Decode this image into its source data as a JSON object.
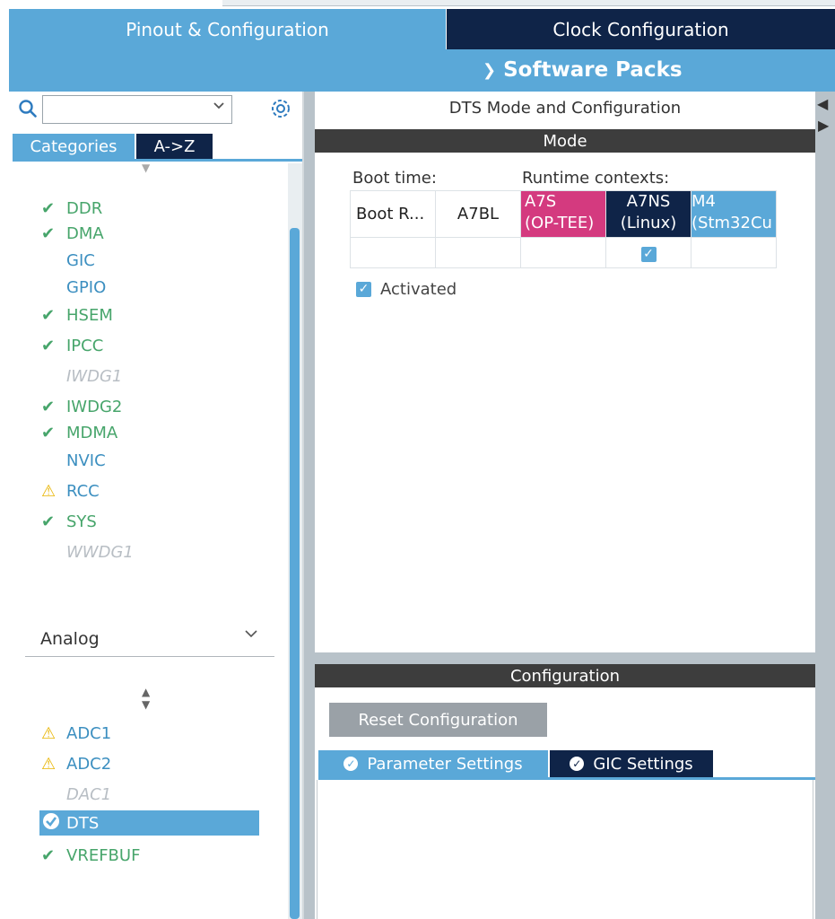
{
  "tabs": {
    "pinout": "Pinout & Configuration",
    "clock": "Clock Configuration",
    "software_packs": "Software Packs"
  },
  "sidebar": {
    "search": {
      "value": ""
    },
    "tab_categories": "Categories",
    "tab_az": "A->Z",
    "system_items": [
      {
        "label": "DDR",
        "status": "ok"
      },
      {
        "label": "DMA",
        "status": "ok"
      },
      {
        "label": "GIC",
        "status": "none"
      },
      {
        "label": "GPIO",
        "status": "none"
      },
      {
        "label": "HSEM",
        "status": "ok"
      },
      {
        "label": "IPCC",
        "status": "ok"
      },
      {
        "label": "IWDG1",
        "status": "disabled"
      },
      {
        "label": "IWDG2",
        "status": "ok"
      },
      {
        "label": "MDMA",
        "status": "ok"
      },
      {
        "label": "NVIC",
        "status": "none"
      },
      {
        "label": "RCC",
        "status": "warning"
      },
      {
        "label": "SYS",
        "status": "ok"
      },
      {
        "label": "WWDG1",
        "status": "disabled"
      }
    ],
    "analog_header": "Analog",
    "analog_items": [
      {
        "label": "ADC1",
        "status": "warning"
      },
      {
        "label": "ADC2",
        "status": "warning"
      },
      {
        "label": "DAC1",
        "status": "disabled"
      },
      {
        "label": "DTS",
        "status": "selected"
      },
      {
        "label": "VREFBUF",
        "status": "ok"
      }
    ]
  },
  "main": {
    "title": "DTS Mode and Configuration",
    "mode_header": "Mode",
    "boot_time_label": "Boot time:",
    "runtime_contexts_label": "Runtime contexts:",
    "contexts": {
      "boot_rom": "Boot R...",
      "a7bl": "A7BL",
      "a7s_line1": "A7S",
      "a7s_line2": "(OP-TEE)",
      "a7ns_line1": "A7NS",
      "a7ns_line2": "(Linux)",
      "m4_line1": "M4",
      "m4_line2": "(Stm32Cu"
    },
    "a7ns_checked": true,
    "activated_label": "Activated",
    "activated_checked": true,
    "configuration_header": "Configuration",
    "reset_button": "Reset Configuration",
    "tab_parameter": "Parameter Settings",
    "tab_gic": "GIC Settings"
  },
  "colors": {
    "accent": "#5aa8d8",
    "navy": "#0f2448",
    "magenta": "#d43a7f",
    "ok_green": "#47a56b",
    "warning_yellow": "#e8b400"
  }
}
